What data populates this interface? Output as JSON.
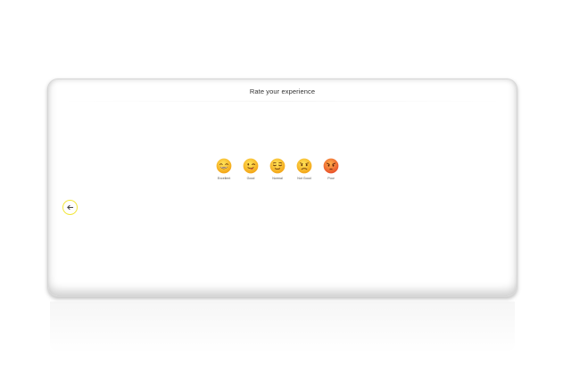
{
  "dialog": {
    "title": "Rate your experience"
  },
  "ratings": [
    {
      "label": "Excellent",
      "icon": "grinning-face-icon"
    },
    {
      "label": "Good",
      "icon": "winking-tongue-face-icon"
    },
    {
      "label": "Normal",
      "icon": "relieved-face-icon"
    },
    {
      "label": "Not Good",
      "icon": "frowning-face-icon"
    },
    {
      "label": "Poor",
      "icon": "angry-face-icon"
    }
  ],
  "back_button": {
    "icon": "arrow-left-icon"
  },
  "colors": {
    "face_yellow": "#fcd12a",
    "face_orange": "#f0a11c",
    "poor_face": "#ef6a2e",
    "back_ring": "#f2e63a"
  }
}
